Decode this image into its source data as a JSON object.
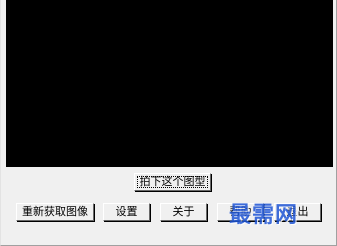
{
  "buttons": {
    "capture": "拍下这个图型",
    "reacquire": "重新获取图像",
    "settings": "设置",
    "about": "关于",
    "help": "帮助",
    "exit": "退出"
  },
  "watermark": {
    "text": "最需网"
  },
  "colors": {
    "viewer_background": "#000000",
    "dialog_background": "#f0f0f0",
    "watermark": "#1f56d6"
  }
}
